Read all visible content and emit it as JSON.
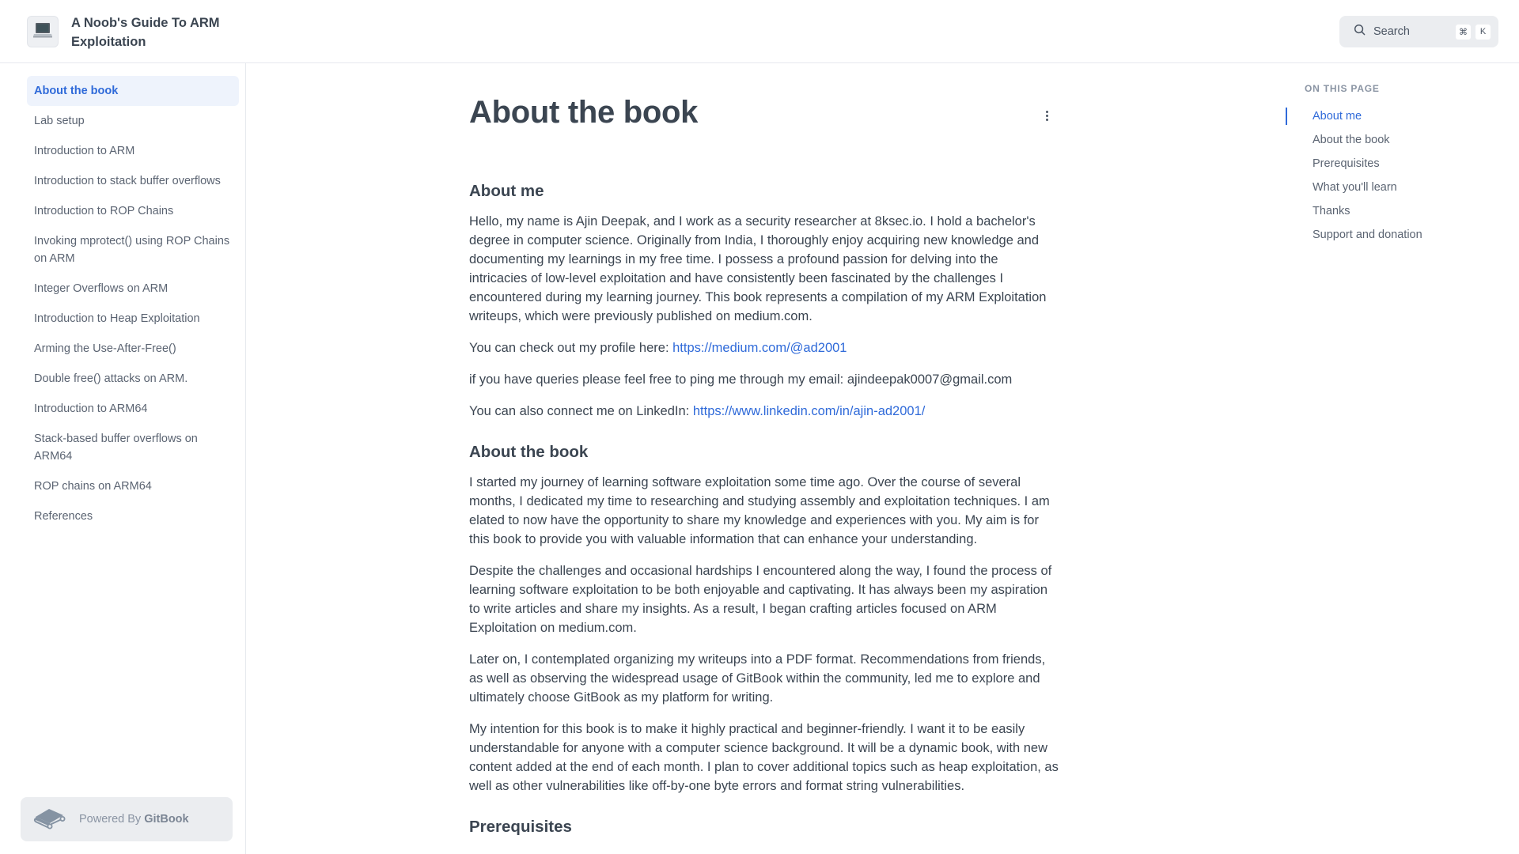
{
  "header": {
    "site_title": "A Noob's Guide To ARM Exploitation",
    "logo_icon": "laptop-icon",
    "search": {
      "label": "Search",
      "shortcut_keys": [
        "⌘",
        "K"
      ]
    }
  },
  "sidebar": {
    "items": [
      {
        "label": "About the book",
        "active": true
      },
      {
        "label": "Lab setup"
      },
      {
        "label": "Introduction to ARM"
      },
      {
        "label": "Introduction to stack buffer overflows"
      },
      {
        "label": "Introduction to ROP Chains"
      },
      {
        "label": "Invoking mprotect() using ROP Chains on ARM"
      },
      {
        "label": "Integer Overflows on ARM"
      },
      {
        "label": "Introduction to Heap Exploitation"
      },
      {
        "label": "Arming the Use-After-Free()"
      },
      {
        "label": "Double free() attacks on ARM."
      },
      {
        "label": "Introduction to ARM64"
      },
      {
        "label": "Stack-based buffer overflows on ARM64"
      },
      {
        "label": "ROP chains on ARM64"
      },
      {
        "label": "References"
      }
    ],
    "powered_by": {
      "prefix": "Powered By ",
      "brand": "GitBook"
    }
  },
  "main": {
    "title": "About the book",
    "sections": {
      "about_me": {
        "heading": "About me",
        "intro": "Hello, my name is Ajin Deepak, and I work as a security researcher at 8ksec.io. I hold a bachelor's degree in computer science. Originally from India, I thoroughly enjoy acquiring new knowledge and documenting my learnings in my free time. I possess a profound passion for delving into the intricacies of low-level exploitation and have consistently been fascinated by the challenges I encountered during my learning journey. This book represents a compilation of my ARM Exploitation writeups, which were previously published on medium.com.",
        "profile_prefix": "You can check out my profile here: ",
        "profile_link": "https://medium.com/@ad2001",
        "email_line": "if you have queries please feel free to ping me through my email: ajindeepak0007@gmail.com",
        "linkedin_prefix": "You can also connect me on LinkedIn: ",
        "linkedin_link": "https://www.linkedin.com/in/ajin-ad2001/"
      },
      "about_book": {
        "heading": "About the book",
        "paragraphs": [
          "I started my journey of learning software exploitation some time ago. Over the course of several months, I dedicated my time to researching and studying assembly and exploitation techniques. I am elated to now have the opportunity to share my knowledge and experiences with you. My aim is for this book to provide you with valuable information that can enhance your understanding.",
          "Despite the challenges and occasional hardships I encountered along the way, I found the process of learning software exploitation to be both enjoyable and captivating. It has always been my aspiration to write articles and share my insights. As a result, I began crafting articles focused on ARM Exploitation on medium.com.",
          "Later on, I contemplated organizing my writeups into a PDF format. Recommendations from friends, as well as observing the widespread usage of GitBook within the community, led me to explore and ultimately choose GitBook as my platform for writing.",
          "My intention for this book is to make it highly practical and beginner-friendly. I want it to be easily understandable for anyone with a computer science background. It will be a dynamic book, with new content added at the end of each month. I plan to cover additional topics such as heap exploitation, as well as other vulnerabilities like off-by-one byte errors and format string vulnerabilities."
        ]
      },
      "prerequisites": {
        "heading": "Prerequisites"
      }
    }
  },
  "toc": {
    "title": "ON THIS PAGE",
    "items": [
      {
        "label": "About me",
        "active": true
      },
      {
        "label": "About the book"
      },
      {
        "label": "Prerequisites"
      },
      {
        "label": "What you'll learn"
      },
      {
        "label": "Thanks"
      },
      {
        "label": "Support and donation"
      }
    ]
  },
  "colors": {
    "accent": "#2f6ad9",
    "text": "#3b4551",
    "muted": "#5b6472",
    "active_bg": "#eef3fc"
  }
}
